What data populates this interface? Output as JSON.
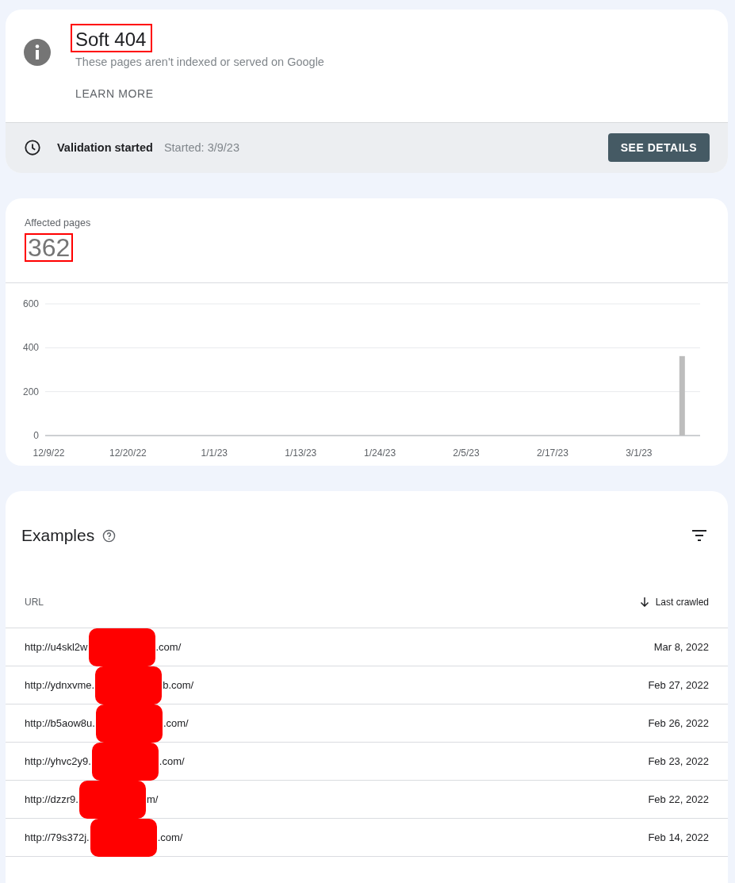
{
  "issue": {
    "title": "Soft 404",
    "title_highlighted": true,
    "description": "These pages aren't indexed or served on Google",
    "learn_more": "LEARN MORE"
  },
  "validation": {
    "status": "Validation started",
    "started": "Started: 3/9/23",
    "button": "SEE DETAILS"
  },
  "affected": {
    "label": "Affected pages",
    "count": "362",
    "count_highlighted": true,
    "chart_data": {
      "type": "bar",
      "ylim": [
        0,
        600
      ],
      "yticks": [
        0,
        200,
        400,
        600
      ],
      "categories": [
        "12/9/22",
        null,
        null,
        null,
        null,
        null,
        null,
        null,
        null,
        null,
        null,
        "12/20/22",
        null,
        null,
        null,
        null,
        null,
        null,
        null,
        null,
        null,
        null,
        null,
        "1/1/23",
        null,
        null,
        null,
        null,
        null,
        null,
        null,
        null,
        null,
        null,
        null,
        "1/13/23",
        null,
        null,
        null,
        null,
        null,
        null,
        null,
        null,
        null,
        null,
        "1/24/23",
        null,
        null,
        null,
        null,
        null,
        null,
        null,
        null,
        null,
        null,
        null,
        "2/5/23",
        null,
        null,
        null,
        null,
        null,
        null,
        null,
        null,
        null,
        null,
        null,
        "2/17/23",
        null,
        null,
        null,
        null,
        null,
        null,
        null,
        null,
        null,
        null,
        null,
        "3/1/23",
        null,
        null,
        null,
        null,
        null,
        null,
        null,
        null
      ],
      "values": [
        null,
        null,
        null,
        null,
        null,
        null,
        null,
        null,
        null,
        null,
        null,
        null,
        null,
        null,
        null,
        null,
        null,
        null,
        null,
        null,
        null,
        null,
        null,
        null,
        null,
        null,
        null,
        null,
        null,
        null,
        null,
        null,
        null,
        null,
        null,
        null,
        null,
        null,
        null,
        null,
        null,
        null,
        null,
        null,
        null,
        null,
        null,
        null,
        null,
        null,
        null,
        null,
        null,
        null,
        null,
        null,
        null,
        null,
        null,
        null,
        null,
        null,
        null,
        null,
        null,
        null,
        null,
        null,
        null,
        null,
        null,
        null,
        null,
        null,
        null,
        null,
        null,
        null,
        null,
        null,
        null,
        null,
        null,
        null,
        null,
        null,
        null,
        null,
        362,
        null,
        null
      ]
    }
  },
  "examples": {
    "title": "Examples",
    "columns": {
      "url": "URL",
      "last_crawled": "Last crawled"
    },
    "rows": [
      {
        "url_start": "http://u4skl2w",
        "url_end": ".com/",
        "last_crawled": "Mar 8, 2022"
      },
      {
        "url_start": "http://ydnxvme.",
        "url_end": "b.com/",
        "last_crawled": "Feb 27, 2022"
      },
      {
        "url_start": "http://b5aow8u.",
        "url_end": ".com/",
        "last_crawled": "Feb 26, 2022"
      },
      {
        "url_start": "http://yhvc2y9.",
        "url_end": ".com/",
        "last_crawled": "Feb 23, 2022"
      },
      {
        "url_start": "http://dzzr9.",
        "url_end": "m/",
        "last_crawled": "Feb 22, 2022"
      },
      {
        "url_start": "http://79s372j.",
        "url_end": ".com/",
        "last_crawled": "Feb 14, 2022"
      }
    ]
  }
}
